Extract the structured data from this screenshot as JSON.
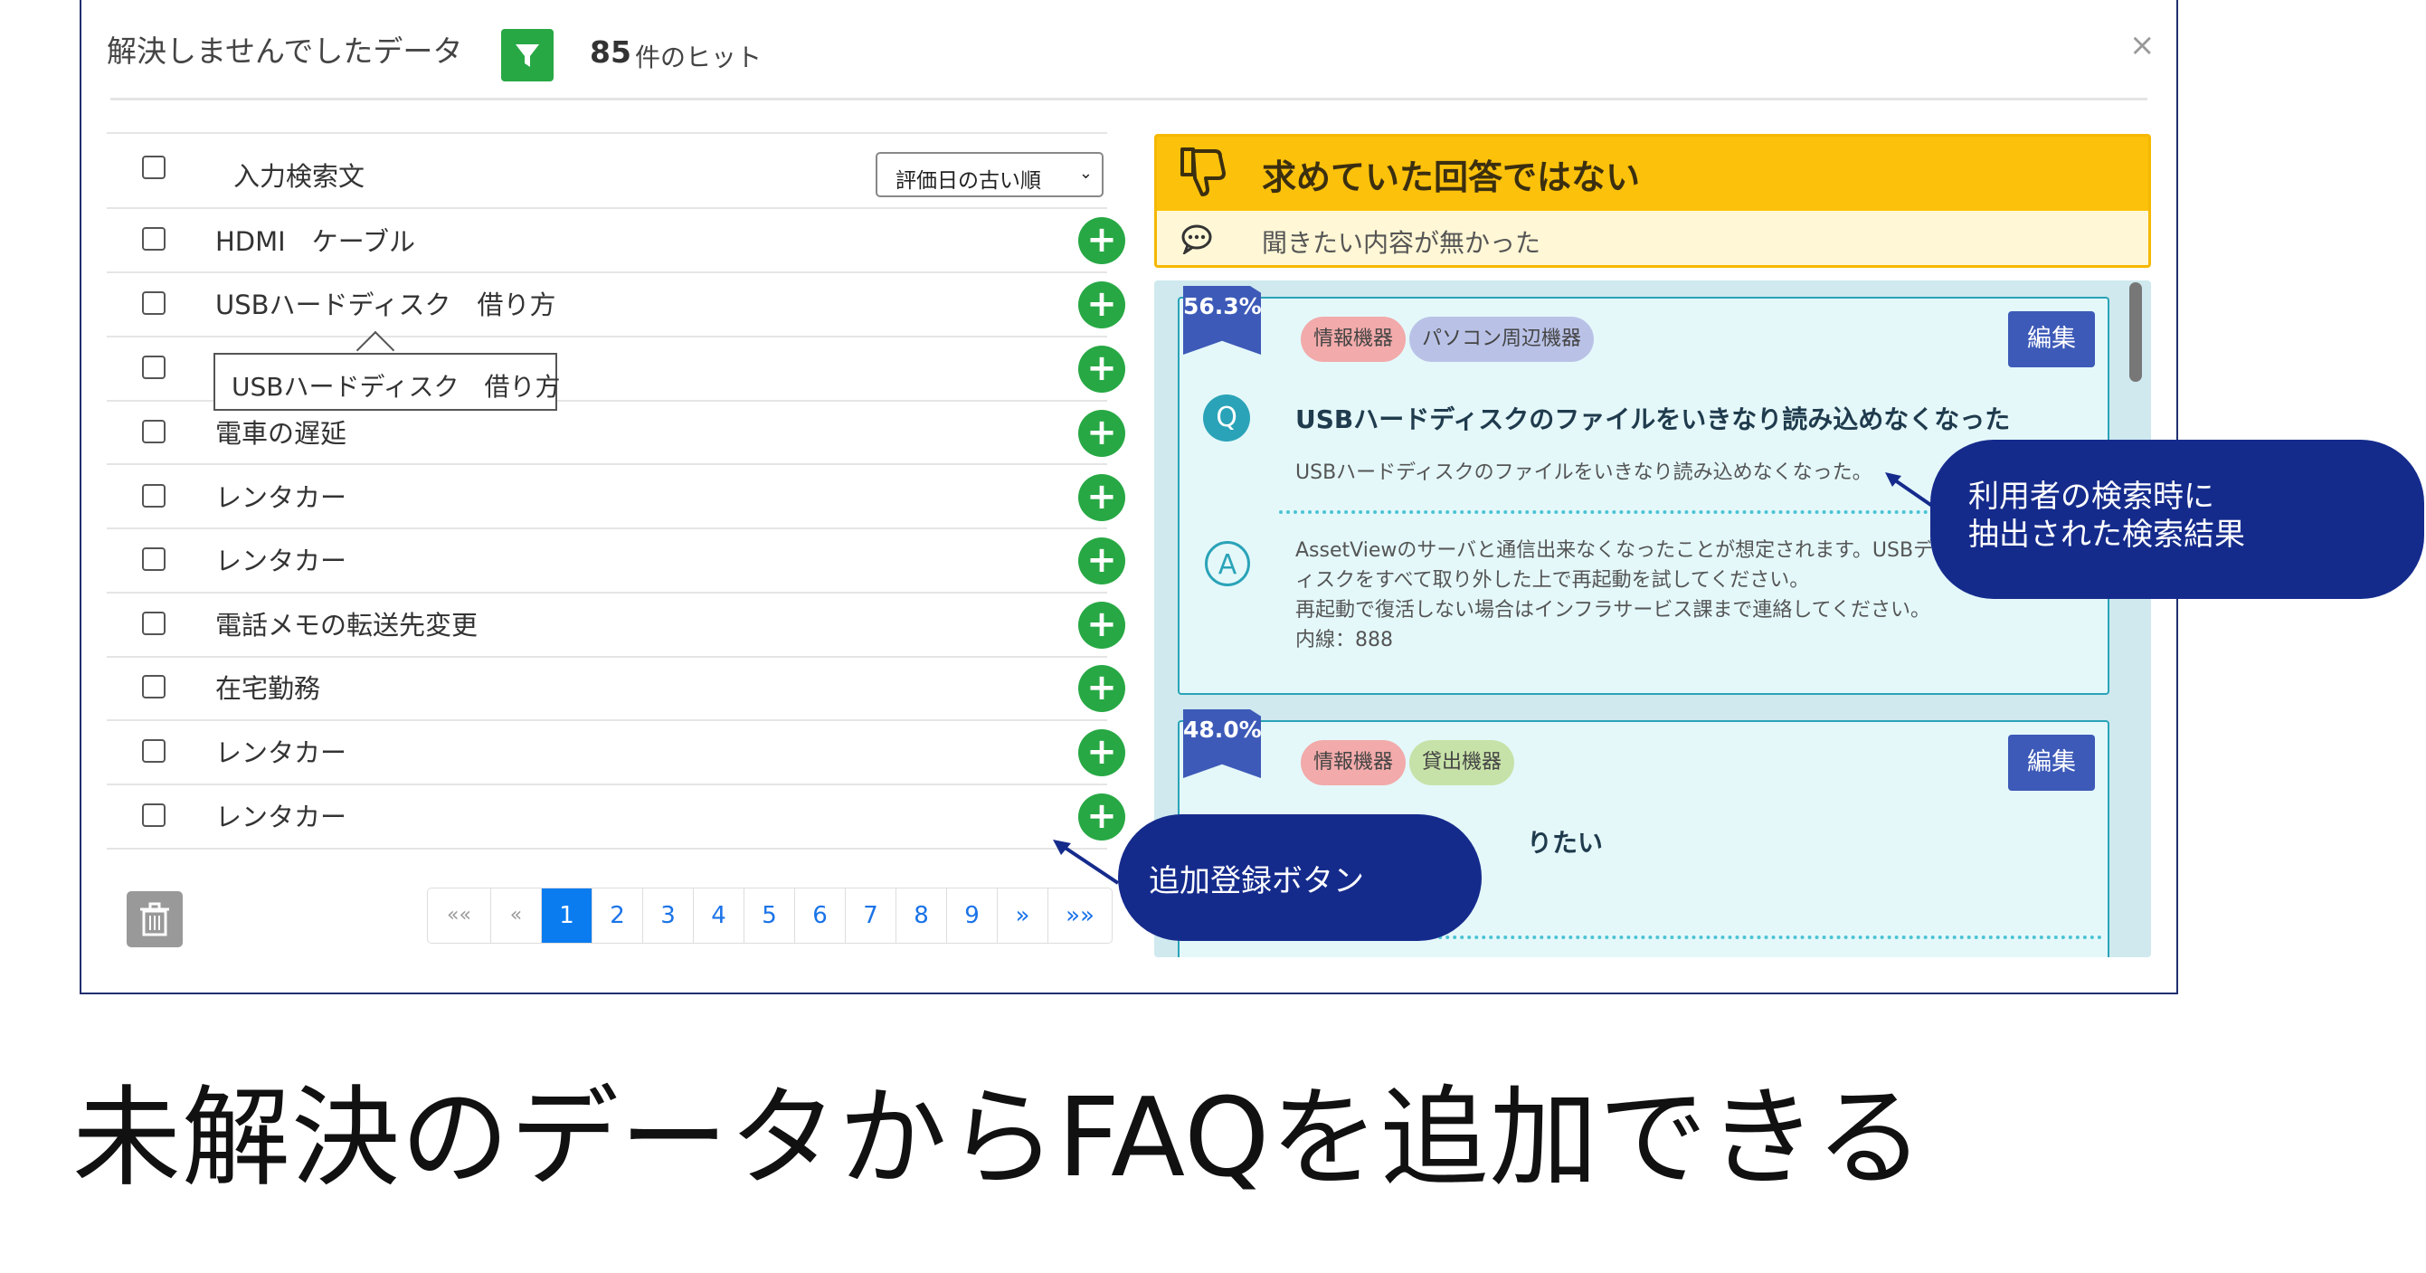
{
  "modal": {
    "title": "解決しませんでしたデータ",
    "hit_count": "85",
    "hit_suffix": "件のヒット",
    "close": "×"
  },
  "list": {
    "header": "入力検索文",
    "sort_selected": "評価日の古い順",
    "rows": [
      "HDMI　ケーブル",
      "USBハードディスク　借り方",
      "",
      "電車の遅延",
      "レンタカー",
      "レンタカー",
      "電話メモの転送先変更",
      "在宅勤務",
      "レンタカー",
      "レンタカー"
    ],
    "tooltip": "USBハードディスク　借り方"
  },
  "pagination": [
    "««",
    "«",
    "1",
    "2",
    "3",
    "4",
    "5",
    "6",
    "7",
    "8",
    "9",
    "»",
    "»»"
  ],
  "pagination_active": "1",
  "right": {
    "header_title": "求めていた回答ではない",
    "header_sub": "聞きたい内容が無かった",
    "cards": [
      {
        "score": "56.3%",
        "tags": [
          "情報機器",
          "パソコン周辺機器"
        ],
        "edit": "編集",
        "q_title": "USBハードディスクのファイルをいきなり読み込めなくなった",
        "q_text": "USBハードディスクのファイルをいきなり読み込めなくなった。",
        "answer": [
          "AssetViewのサーバと通信出来なくなったことが想定されます。USBデ",
          "ィスクをすべて取り外した上で再起動を試してください。",
          "再起動で復活しない場合はインフラサービス課まで連絡してください。",
          "内線：888"
        ]
      },
      {
        "score": "48.0%",
        "tags": [
          "情報機器",
          "貸出機器"
        ],
        "edit": "編集",
        "q_title_partial": "りたい"
      }
    ]
  },
  "callouts": {
    "search_result": [
      "利用者の検索時に",
      "抽出された検索結果"
    ],
    "add_button": "追加登録ボタン"
  },
  "caption": "未解決のデータからFAQを追加できる",
  "colors": {
    "green": "#27a844",
    "navy": "#152b8c",
    "amber": "#fcc10a",
    "teal": "#2aa3b8",
    "blue_active": "#0b7cf0"
  }
}
